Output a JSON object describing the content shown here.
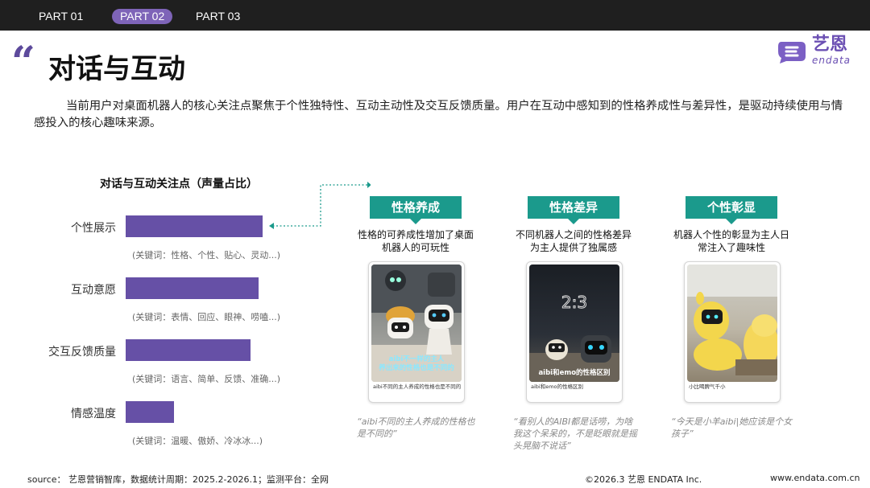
{
  "nav": {
    "tabs": [
      {
        "label": "PART 01",
        "active": false
      },
      {
        "label": "PART 02",
        "active": true
      },
      {
        "label": "PART 03",
        "active": false
      }
    ]
  },
  "header": {
    "quote_glyph": "“",
    "title": "对话与互动"
  },
  "logo": {
    "cn": "艺恩",
    "en": "endata",
    "color": "#6b4fb3"
  },
  "intro": "当前用户对桌面机器人的核心关注点聚焦于个性独特性、互动主动性及交互反馈质量。用户在互动中感知到的性格养成性与差异性，是驱动持续使用与情感投入的核心趣味来源。",
  "chart_data": {
    "type": "bar",
    "orientation": "horizontal",
    "title": "对话与互动关注点（声量占比）",
    "categories": [
      "个性展示",
      "互动意愿",
      "交互反馈质量",
      "情感温度"
    ],
    "values": [
      34,
      33,
      31,
      12
    ],
    "keywords": [
      "(关键词：性格、个性、贴心、灵动...)",
      "(关键词：表情、回应、眼神、唠嗑...)",
      "(关键词：语言、简单、反馈、准确...)",
      "(关键词：温暖、傲娇、冷冰冰...)"
    ],
    "bar_color": "#6650a6",
    "axis_visible": false,
    "grid": false
  },
  "cards": [
    {
      "heading": "性格养成",
      "description": "性格的可养成性增加了桌面机器人的可玩性",
      "overlay": [
        "aibi不一样的主人",
        "养出来的性格也是不同的"
      ],
      "caption": "aibi不同的主人养成的性格也是不同的",
      "quote": "“aibi不同的主人养成的性格也是不同的”"
    },
    {
      "heading": "性格差异",
      "description": "不同机器人之间的性格差异为主人提供了独属感",
      "overlay": [
        "aibi和emo的性格区别"
      ],
      "caption": "aibi和emo的性格区别",
      "quote": "“看别人的AIBI都是话唠，为啥我这个呆呆的，不是眨眼就是摇头晃脑不说话”"
    },
    {
      "heading": "个性彰显",
      "description": "机器人个性的彰显为主人日常注入了趣味性",
      "overlay": [],
      "caption": "小比喝脾气千小",
      "quote": "“今天是小羊aibi|她应该是个女孩子”"
    }
  ],
  "accent": {
    "teal": "#1b9a8c",
    "purple": "#5d4a9c"
  },
  "footer": {
    "source": "source： 艺恩营销智库，数据统计周期：2025.2-2026.1；监测平台：全网",
    "copyright": "©2026.3  艺恩 ENDATA Inc.",
    "url": "www.endata.com.cn"
  }
}
